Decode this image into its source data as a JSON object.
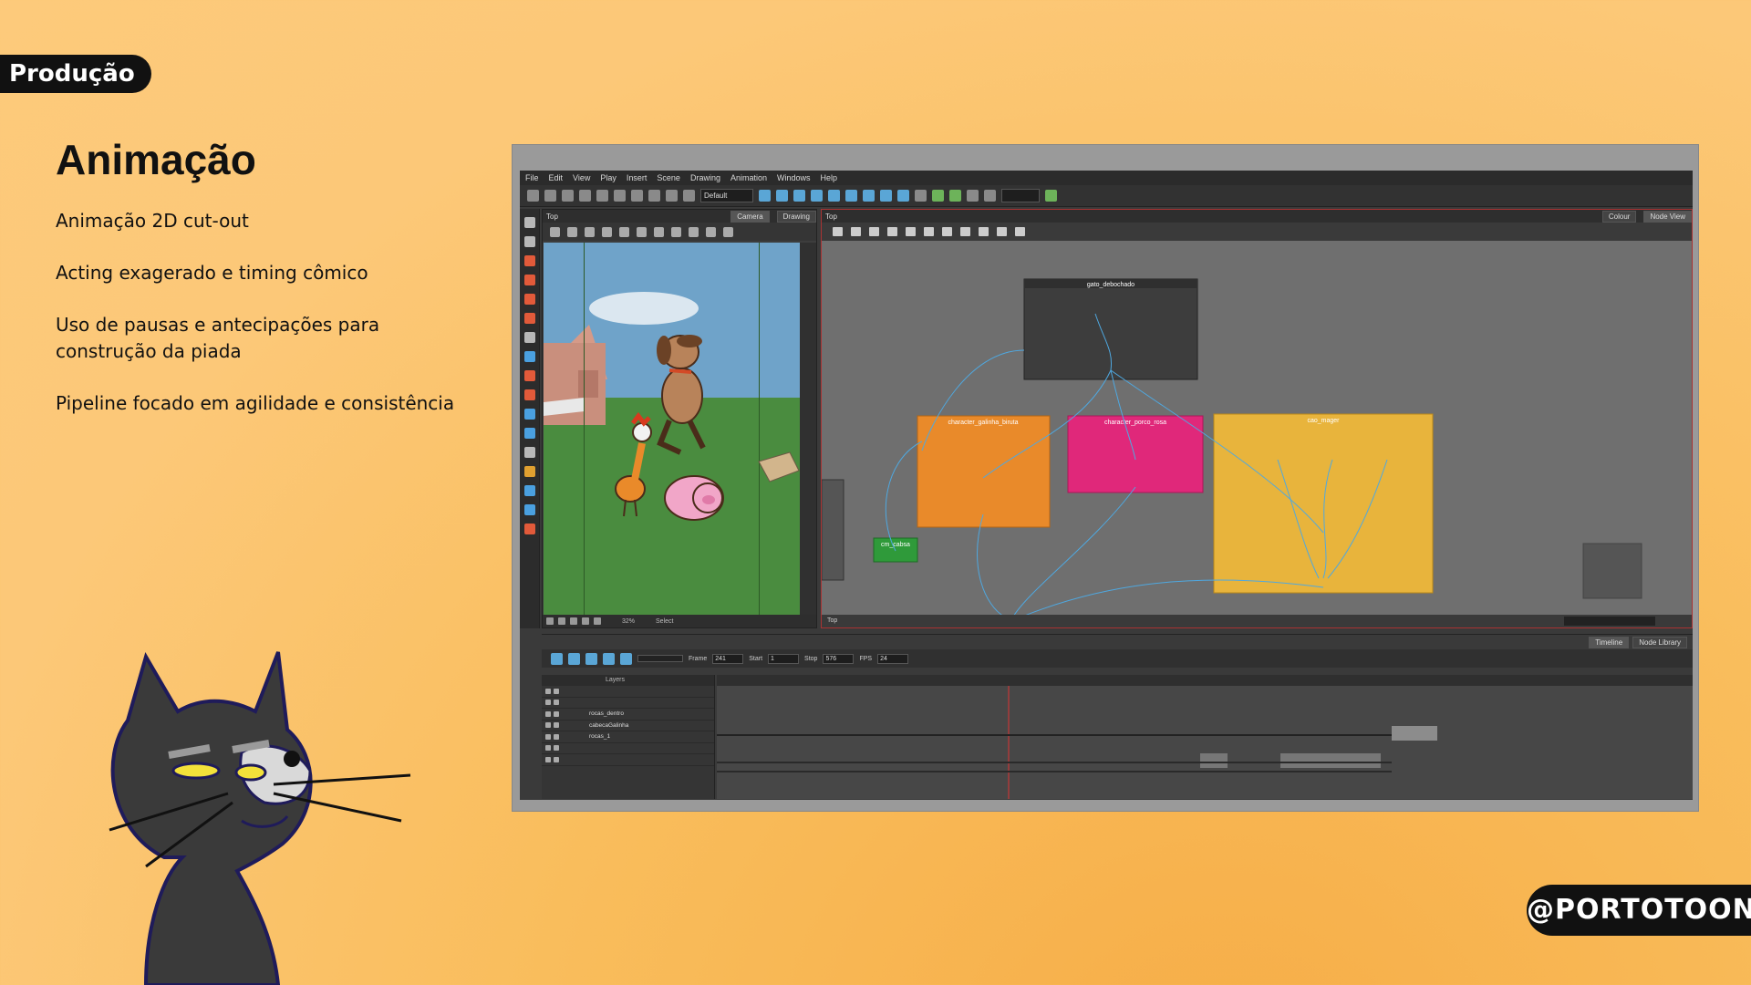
{
  "slide": {
    "section_tag": "Produção",
    "title": "Animação",
    "bullets": [
      "Animação 2D cut-out",
      "Acting exagerado e timing cômico",
      "Uso de pausas e antecipações para construção da piada",
      "Pipeline focado em agilidade e consistência"
    ],
    "handle": "@PORTOTOONZ"
  },
  "app": {
    "menu": [
      "File",
      "Edit",
      "View",
      "Play",
      "Insert",
      "Scene",
      "Drawing",
      "Animation",
      "Windows",
      "Help"
    ],
    "workspace_select": "Default",
    "camera_panel": {
      "title": "Top",
      "tabs": [
        "Camera",
        "Drawing"
      ],
      "zoom": "32%",
      "status": "Select"
    },
    "node_view": {
      "title": "Top",
      "tabs": [
        "Colour",
        "Node View"
      ],
      "status": "Top",
      "nodes": [
        {
          "label": "gato_debochado",
          "color": "#3a3a3a"
        },
        {
          "label": "character_galinha_birutа",
          "color": "#e98a2a"
        },
        {
          "label": "character_porco_rosa",
          "color": "#e0287a"
        },
        {
          "label": "cao_mager",
          "color": "#e8b43c"
        },
        {
          "label": "cm_cabsa",
          "color": "#2f9a3a"
        }
      ]
    },
    "timeline": {
      "tabs": [
        "Timeline",
        "Node Library"
      ],
      "frame_label": "Frame",
      "frame_value": "241",
      "start_label": "Start",
      "start_value": "1",
      "stop_label": "Stop",
      "stop_value": "576",
      "fps_label": "FPS",
      "fps_value": "24",
      "layers_header": "Layers",
      "layers": [
        {
          "name": "",
          "red": true
        },
        {
          "name": "",
          "red": true
        },
        {
          "name": "rocas_dentro",
          "red": false
        },
        {
          "name": "cabecaGalinha",
          "red": false
        },
        {
          "name": "rocas_1",
          "red": false
        },
        {
          "name": "",
          "red": true
        },
        {
          "name": "",
          "red": true
        }
      ]
    }
  }
}
